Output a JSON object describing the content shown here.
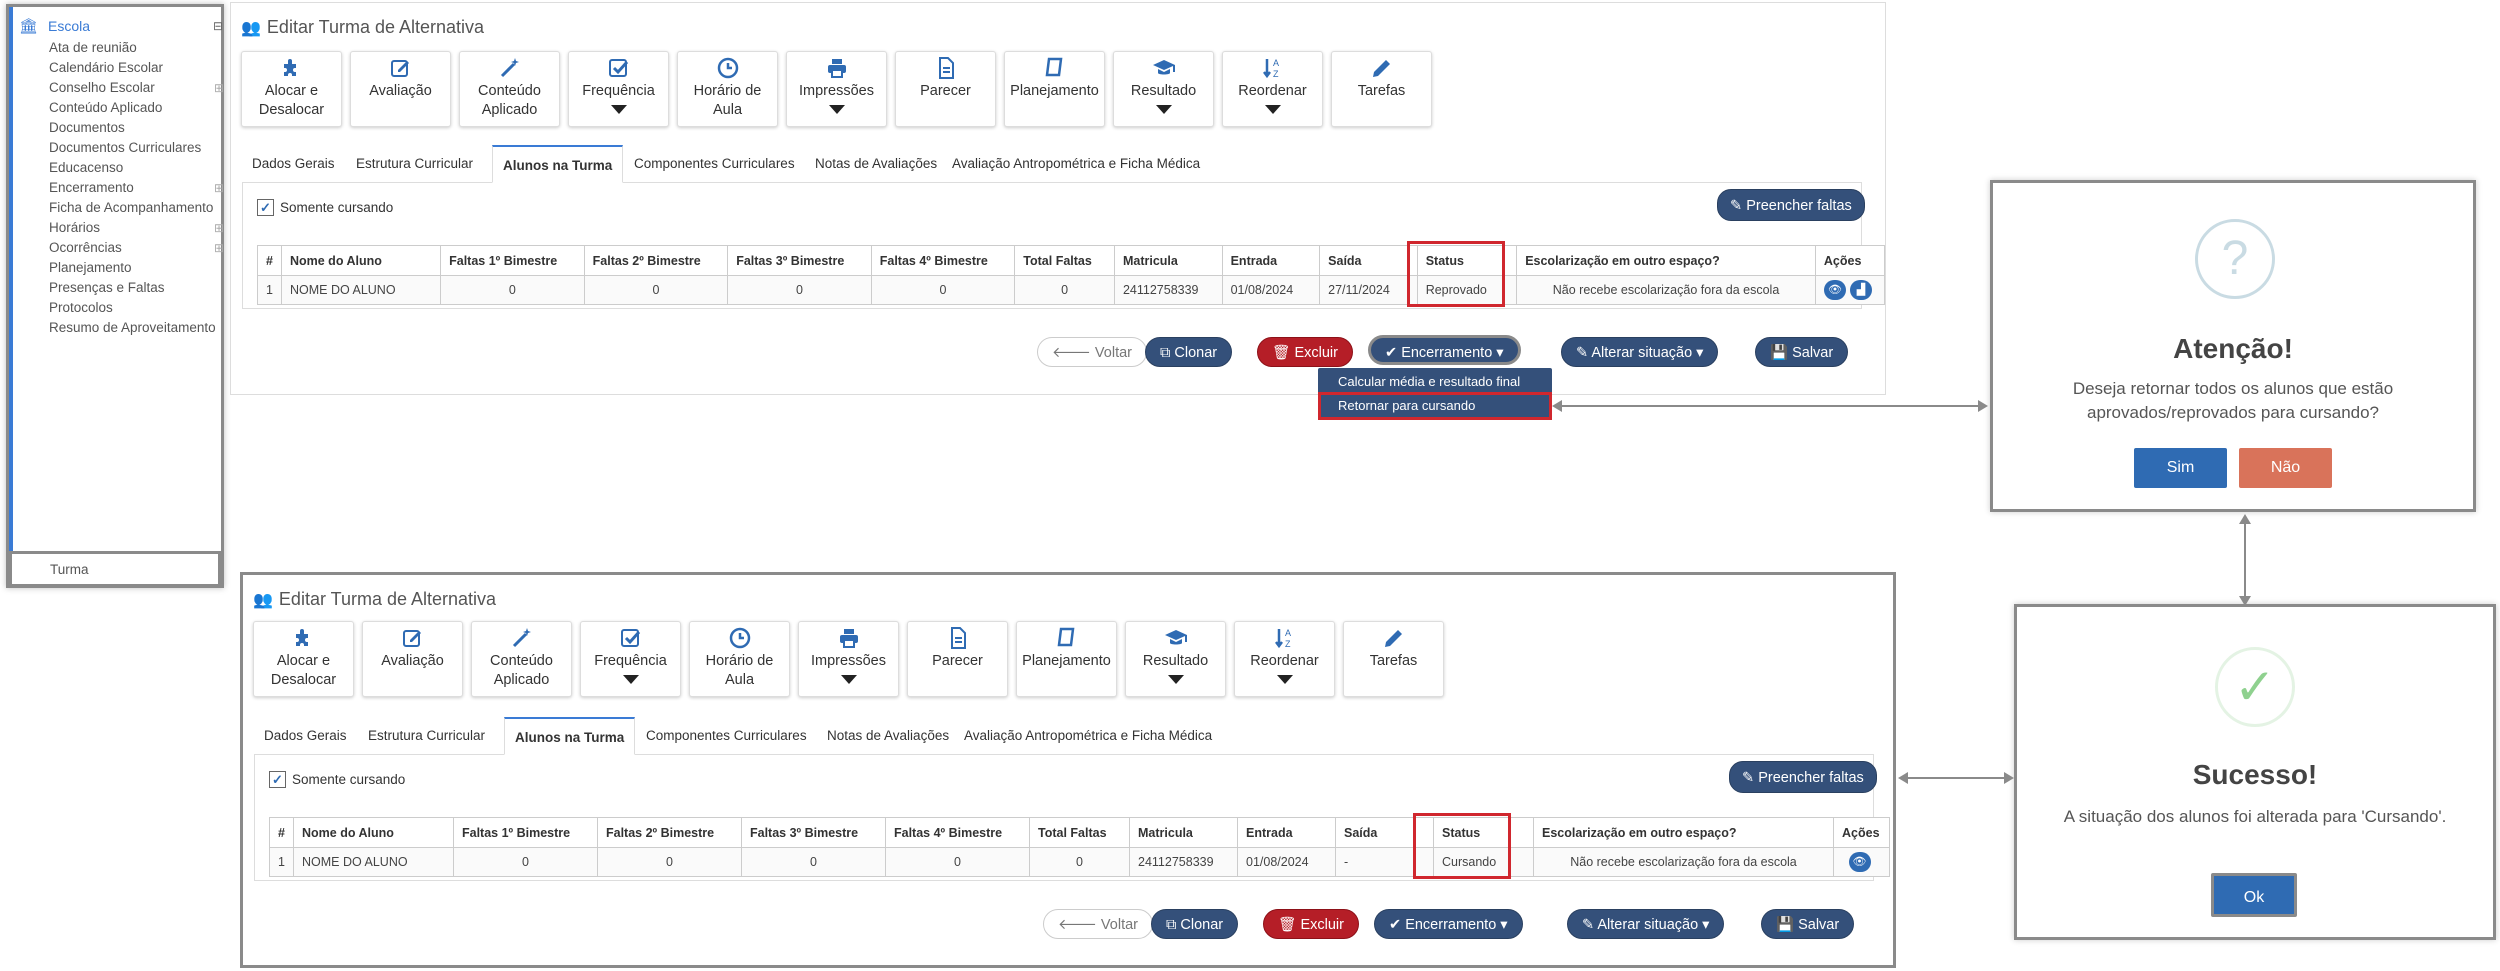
{
  "sidebar": {
    "head": "Escola",
    "head_collapse": "⊟",
    "items": [
      {
        "label": "Ata de reunião",
        "plus": ""
      },
      {
        "label": "Calendário Escolar",
        "plus": ""
      },
      {
        "label": "Conselho Escolar",
        "plus": "⊞"
      },
      {
        "label": "Conteúdo Aplicado",
        "plus": ""
      },
      {
        "label": "Documentos",
        "plus": ""
      },
      {
        "label": "Documentos Curriculares",
        "plus": ""
      },
      {
        "label": "Educacenso",
        "plus": ""
      },
      {
        "label": "Encerramento",
        "plus": "⊞"
      },
      {
        "label": "Ficha de Acompanhamento",
        "plus": ""
      },
      {
        "label": "Horários",
        "plus": "⊞"
      },
      {
        "label": "Ocorrências",
        "plus": "⊞"
      },
      {
        "label": "Planejamento",
        "plus": ""
      },
      {
        "label": "Presenças e Faltas",
        "plus": ""
      },
      {
        "label": "Protocolos",
        "plus": ""
      },
      {
        "label": "Resumo de Aproveitamento",
        "plus": ""
      }
    ],
    "turma": "Turma"
  },
  "panel": {
    "title": "Editar Turma de Alternativa",
    "toolbar": [
      {
        "label": "Alocar e Desalocar",
        "icon": "puzzle-icon",
        "caret": false
      },
      {
        "label": "Avaliação",
        "icon": "edit-icon",
        "caret": false
      },
      {
        "label": "Conteúdo Aplicado",
        "icon": "magic-wand-icon",
        "caret": false
      },
      {
        "label": "Frequência",
        "icon": "checkbox-icon",
        "caret": true
      },
      {
        "label": "Horário de Aula",
        "icon": "clock-icon",
        "caret": false
      },
      {
        "label": "Impressões",
        "icon": "printer-icon",
        "caret": true
      },
      {
        "label": "Parecer",
        "icon": "document-icon",
        "caret": false
      },
      {
        "label": "Planejamento",
        "icon": "book-icon",
        "caret": false
      },
      {
        "label": "Resultado",
        "icon": "graduation-cap-icon",
        "caret": true
      },
      {
        "label": "Reordenar",
        "icon": "sort-alpha-icon",
        "caret": true
      },
      {
        "label": "Tarefas",
        "icon": "pencil-icon",
        "caret": false
      }
    ],
    "tabs": [
      "Dados Gerais",
      "Estrutura Curricular",
      "Alunos na Turma",
      "Componentes Curriculares",
      "Notas de Avaliações",
      "Avaliação Antropométrica e Ficha Médica"
    ],
    "checkbox_label": "Somente cursando",
    "preencher_label": "Preencher faltas",
    "columns": [
      "#",
      "Nome do Aluno",
      "Faltas 1º Bimestre",
      "Faltas 2º Bimestre",
      "Faltas 3º Bimestre",
      "Faltas 4º Bimestre",
      "Total Faltas",
      "Matricula",
      "Entrada",
      "Saída",
      "Status",
      "Escolarização em outro espaço?",
      "Ações"
    ],
    "buttons": {
      "voltar": "Voltar",
      "clonar": "Clonar",
      "excluir": "Excluir",
      "encerramento": "Encerramento",
      "alterar": "Alterar situação",
      "salvar": "Salvar"
    }
  },
  "top_row": [
    "1",
    "NOME DO ALUNO",
    "0",
    "0",
    "0",
    "0",
    "0",
    "24112758339",
    "01/08/2024",
    "27/11/2024",
    "Reprovado",
    "Não recebe escolarização fora da escola"
  ],
  "bottom_row": [
    "1",
    "NOME DO ALUNO",
    "0",
    "0",
    "0",
    "0",
    "0",
    "24112758339",
    "01/08/2024",
    "-",
    "Cursando",
    "Não recebe escolarização fora da escola"
  ],
  "dropdown": {
    "item1": "Calcular média e resultado final",
    "item2": "Retornar para cursando"
  },
  "modal_confirm": {
    "icon": "?",
    "title": "Atenção!",
    "body": "Deseja retornar todos os alunos que estão aprovados/reprovados para cursando?",
    "yes": "Sim",
    "no": "Não"
  },
  "modal_success": {
    "icon": "✓",
    "title": "Sucesso!",
    "body": "A situação dos alunos foi alterada para 'Cursando'.",
    "ok": "Ok"
  },
  "colors": {
    "accent": "#3a7bd5",
    "dark_button": "#34507a",
    "danger": "#b51e27",
    "highlight": "#d0272e",
    "confirm_yes": "#2f6bb3",
    "confirm_no": "#d9735a",
    "success_check": "#8fd18f"
  }
}
